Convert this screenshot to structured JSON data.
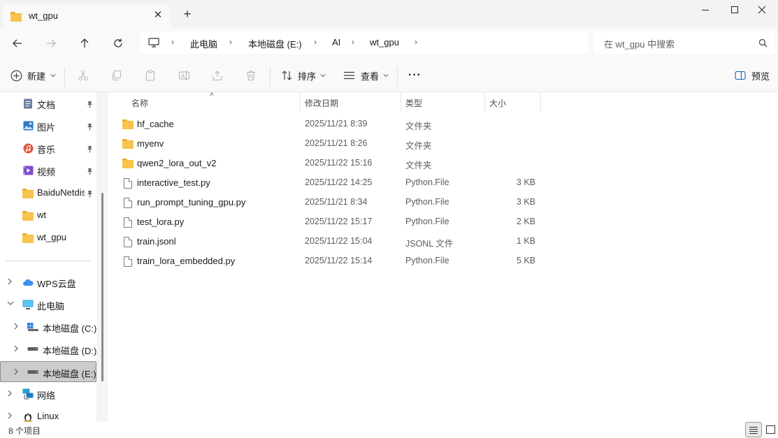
{
  "window": {
    "tab_title": "wt_gpu",
    "tab_close": "✕",
    "new_tab": "+"
  },
  "address_bar": {
    "crumbs": [
      "此电脑",
      "本地磁盘 (E:)",
      "AI",
      "wt_gpu"
    ],
    "separator": "›"
  },
  "search": {
    "placeholder": "在 wt_gpu 中搜索"
  },
  "command_bar": {
    "new_label": "新建",
    "sort_label": "排序",
    "view_label": "查看",
    "more_label": "···",
    "preview_label": "预览"
  },
  "sidebar": {
    "quick_access": [
      {
        "label": "文档",
        "icon": "documents-icon",
        "pinned": true
      },
      {
        "label": "图片",
        "icon": "pictures-icon",
        "pinned": true
      },
      {
        "label": "音乐",
        "icon": "music-icon",
        "pinned": true
      },
      {
        "label": "视频",
        "icon": "videos-icon",
        "pinned": true
      },
      {
        "label": "BaiduNetdisk",
        "icon": "folder-icon",
        "pinned": true
      },
      {
        "label": "wt",
        "icon": "folder-icon",
        "pinned": false
      },
      {
        "label": "wt_gpu",
        "icon": "folder-icon",
        "pinned": false
      }
    ],
    "tree": [
      {
        "label": "WPS云盘",
        "icon": "cloud-icon",
        "expanded": false
      },
      {
        "label": "此电脑",
        "icon": "pc-icon",
        "expanded": true
      },
      {
        "label": "本地磁盘 (C:)",
        "icon": "windows-drive-icon",
        "expanded": false
      },
      {
        "label": "本地磁盘 (D:)",
        "icon": "drive-icon",
        "expanded": false
      },
      {
        "label": "本地磁盘 (E:)",
        "icon": "drive-icon",
        "expanded": false,
        "selected": true
      },
      {
        "label": "网络",
        "icon": "network-icon",
        "expanded": false
      },
      {
        "label": "Linux",
        "icon": "linux-icon",
        "expanded": false
      }
    ]
  },
  "file_list": {
    "columns": {
      "name": "名称",
      "modified": "修改日期",
      "type": "类型",
      "size": "大小"
    },
    "sort_indicator": "˄",
    "rows": [
      {
        "name": "hf_cache",
        "modified": "2025/11/21 8:39",
        "type": "文件夹",
        "size": "",
        "kind": "folder"
      },
      {
        "name": "myenv",
        "modified": "2025/11/21 8:26",
        "type": "文件夹",
        "size": "",
        "kind": "folder"
      },
      {
        "name": "qwen2_lora_out_v2",
        "modified": "2025/11/22 15:16",
        "type": "文件夹",
        "size": "",
        "kind": "folder"
      },
      {
        "name": "interactive_test.py",
        "modified": "2025/11/22 14:25",
        "type": "Python.File",
        "size": "3 KB",
        "kind": "file"
      },
      {
        "name": "run_prompt_tuning_gpu.py",
        "modified": "2025/11/21 8:34",
        "type": "Python.File",
        "size": "3 KB",
        "kind": "file"
      },
      {
        "name": "test_lora.py",
        "modified": "2025/11/22 15:17",
        "type": "Python.File",
        "size": "2 KB",
        "kind": "file"
      },
      {
        "name": "train.jsonl",
        "modified": "2025/11/22 15:04",
        "type": "JSONL 文件",
        "size": "1 KB",
        "kind": "file"
      },
      {
        "name": "train_lora_embedded.py",
        "modified": "2025/11/22 15:14",
        "type": "Python.File",
        "size": "5 KB",
        "kind": "file"
      }
    ]
  },
  "status_bar": {
    "item_count": "8 个项目"
  },
  "colors": {
    "folder": "#f8c44d",
    "selection": "#cccccc",
    "chrome": "#f3f3f3"
  }
}
